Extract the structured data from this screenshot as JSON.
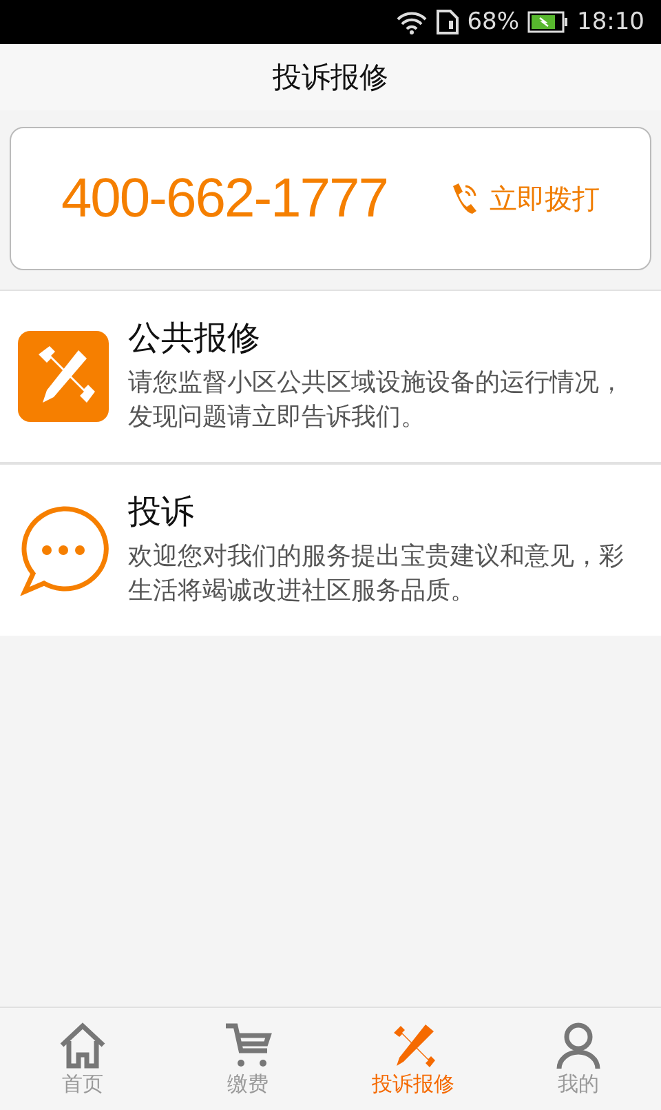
{
  "status_bar": {
    "battery_percent": "68%",
    "time": "18:10"
  },
  "header": {
    "title": "投诉报修"
  },
  "hotline": {
    "number": "400-662-1777",
    "call_label": "立即拨打"
  },
  "services": [
    {
      "kind": "repair",
      "title": "公共报修",
      "description": "请您监督小区公共区域设施设备的运行情况，发现问题请立即告诉我们。"
    },
    {
      "kind": "complaint",
      "title": "投诉",
      "description": "欢迎您对我们的服务提出宝贵建议和意见，彩生活将竭诚改进社区服务品质。"
    }
  ],
  "tabs": [
    {
      "kind": "home",
      "label": "首页",
      "selected": false
    },
    {
      "kind": "cart",
      "label": "缴费",
      "selected": false
    },
    {
      "kind": "tools",
      "label": "投诉报修",
      "selected": true
    },
    {
      "kind": "person",
      "label": "我的",
      "selected": false
    }
  ]
}
